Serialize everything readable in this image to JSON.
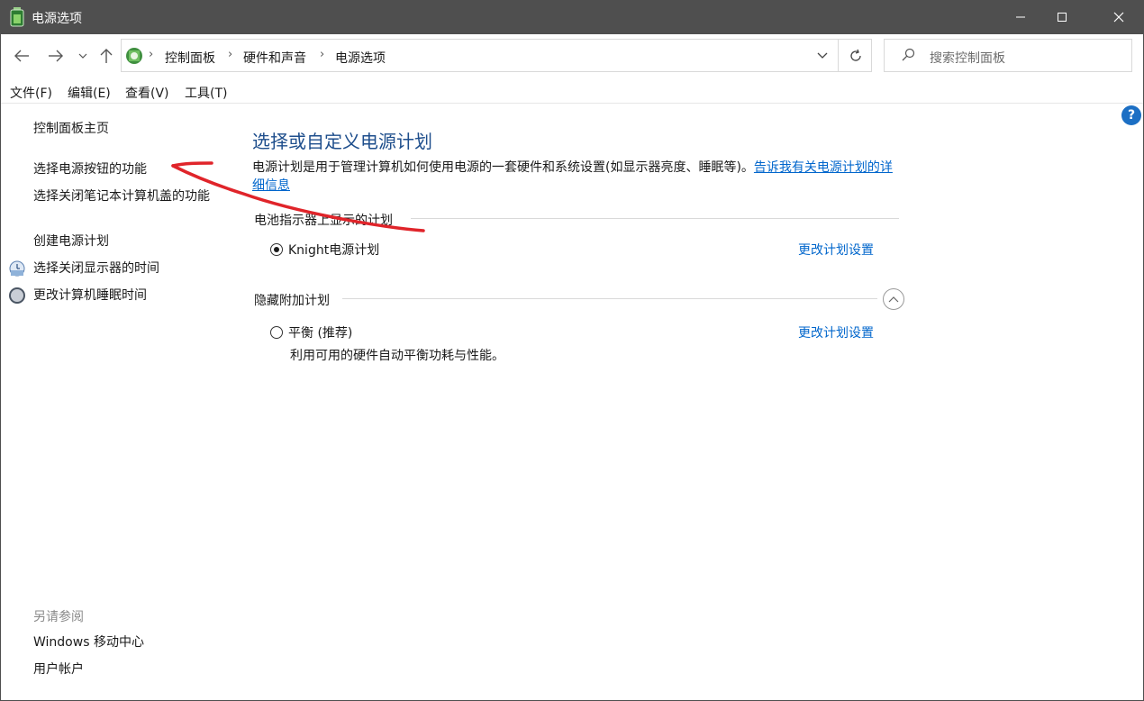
{
  "window": {
    "title": "电源选项",
    "icon": "power-options-battery-icon"
  },
  "nav": {
    "breadcrumbs": [
      "控制面板",
      "硬件和声音",
      "电源选项"
    ],
    "search_placeholder": "搜索控制面板"
  },
  "menu": {
    "items": [
      "文件(F)",
      "编辑(E)",
      "查看(V)",
      "工具(T)"
    ]
  },
  "sidebar": {
    "home_link": "控制面板主页",
    "links": [
      "选择电源按钮的功能",
      "选择关闭笔记本计算机盖的功能",
      "创建电源计划",
      "选择关闭显示器的时间",
      "更改计算机睡眠时间"
    ],
    "see_also_label": "另请参阅",
    "see_also_links": [
      "Windows 移动中心",
      "用户帐户"
    ]
  },
  "main": {
    "heading": "选择或自定义电源计划",
    "description": "电源计划是用于管理计算机如何使用电源的一套硬件和系统设置(如显示器亮度、睡眠等)。",
    "description_link": "告诉我有关电源计划的详细信息",
    "battery_section_label": "电池指示器上显示的计划",
    "hidden_section_label": "隐藏附加计划",
    "plans": [
      {
        "name": "Knight电源计划",
        "selected": true,
        "change_link": "更改计划设置",
        "description": ""
      },
      {
        "name": "平衡 (推荐)",
        "selected": false,
        "change_link": "更改计划设置",
        "description": "利用可用的硬件自动平衡功耗与性能。"
      }
    ]
  },
  "annotation": {
    "color": "#e0242a"
  },
  "colors": {
    "titlebar": "#4f4f4f",
    "heading": "#1e4e8c",
    "link": "#0066cc",
    "help": "#1c6fc4"
  }
}
